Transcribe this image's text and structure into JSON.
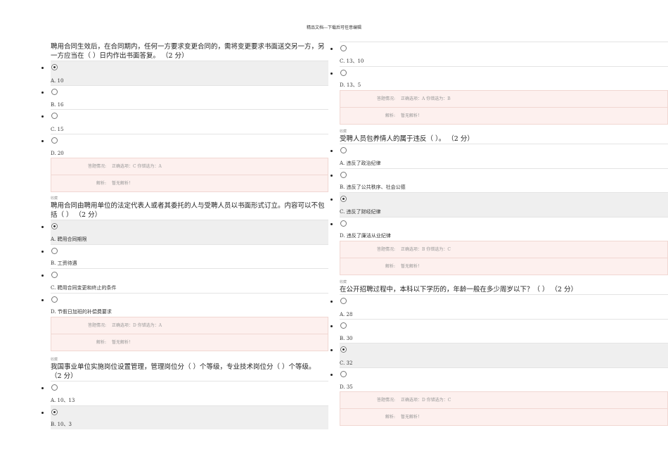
{
  "header": "精品文档---下载后可任意编辑",
  "feedback_labels": {
    "status": "答题情况:",
    "analysis": "解析:"
  },
  "questions": [
    {
      "tag": "",
      "stem": "聘用合同生效后，在合同期内，任何一方要求变更合同的，需将变更要求书面送交另一方，另一方应当在（ ）日内作出书面答复。 （2 分）",
      "options": [
        {
          "label": "A. 10",
          "selected": true
        },
        {
          "label": "B. 16",
          "selected": false
        },
        {
          "label": "C. 15",
          "selected": false
        },
        {
          "label": "D. 20",
          "selected": false
        }
      ],
      "status": "正确选项：C 你错选为：A",
      "analysis": "暂无解析！"
    },
    {
      "tag": "收藏",
      "stem": "聘用合同由聘用单位的法定代表人或者其委托的人与受聘人员以书面形式订立。内容可以不包括（ ） （2 分）",
      "options": [
        {
          "label": "A. 聘用合同期限",
          "selected": true
        },
        {
          "label": "B. 工资待遇",
          "selected": false
        },
        {
          "label": "C. 聘用合同变更和终止的条件",
          "selected": false
        },
        {
          "label": "D. 节假日加班的补偿费要求",
          "selected": false
        }
      ],
      "status": "正确选项：D 你错选为：A",
      "analysis": "暂无解析！"
    },
    {
      "tag": "收藏",
      "stem": "我国事业单位实施岗位设置管理，管理岗位分（ ）个等级，专业技术岗位分（ ）个等级。 （2 分）",
      "options": [
        {
          "label": "A. 10、13",
          "selected": false
        },
        {
          "label": "B. 10、3",
          "selected": true
        },
        {
          "label": "C. 13、10",
          "selected": false
        },
        {
          "label": "D. 13、5",
          "selected": false
        }
      ],
      "status": "正确选项：A 你错选为：B",
      "analysis": "暂无解析！"
    },
    {
      "tag": "收藏",
      "stem": "受聘人员包养情人的属于违反（ ）。 （2 分）",
      "options": [
        {
          "label": "A. 违反了政治纪律",
          "selected": false
        },
        {
          "label": "B. 违反了公共秩序、社会公德",
          "selected": false
        },
        {
          "label": "C. 违反了财经纪律",
          "selected": true
        },
        {
          "label": "D. 违反了廉洁从业纪律",
          "selected": false
        }
      ],
      "status": "正确选项：B 你错选为：C",
      "analysis": "暂无解析！"
    },
    {
      "tag": "收藏",
      "stem": "在公开招聘过程中，本科以下学历的，年龄一般在多少周岁以下？（ ） （2 分）",
      "options": [
        {
          "label": "A. 28",
          "selected": false
        },
        {
          "label": "B. 30",
          "selected": false
        },
        {
          "label": "C. 32",
          "selected": true
        },
        {
          "label": "D. 35",
          "selected": false
        }
      ],
      "status": "正确选项：D 你错选为：C",
      "analysis": "暂无解析！"
    }
  ]
}
